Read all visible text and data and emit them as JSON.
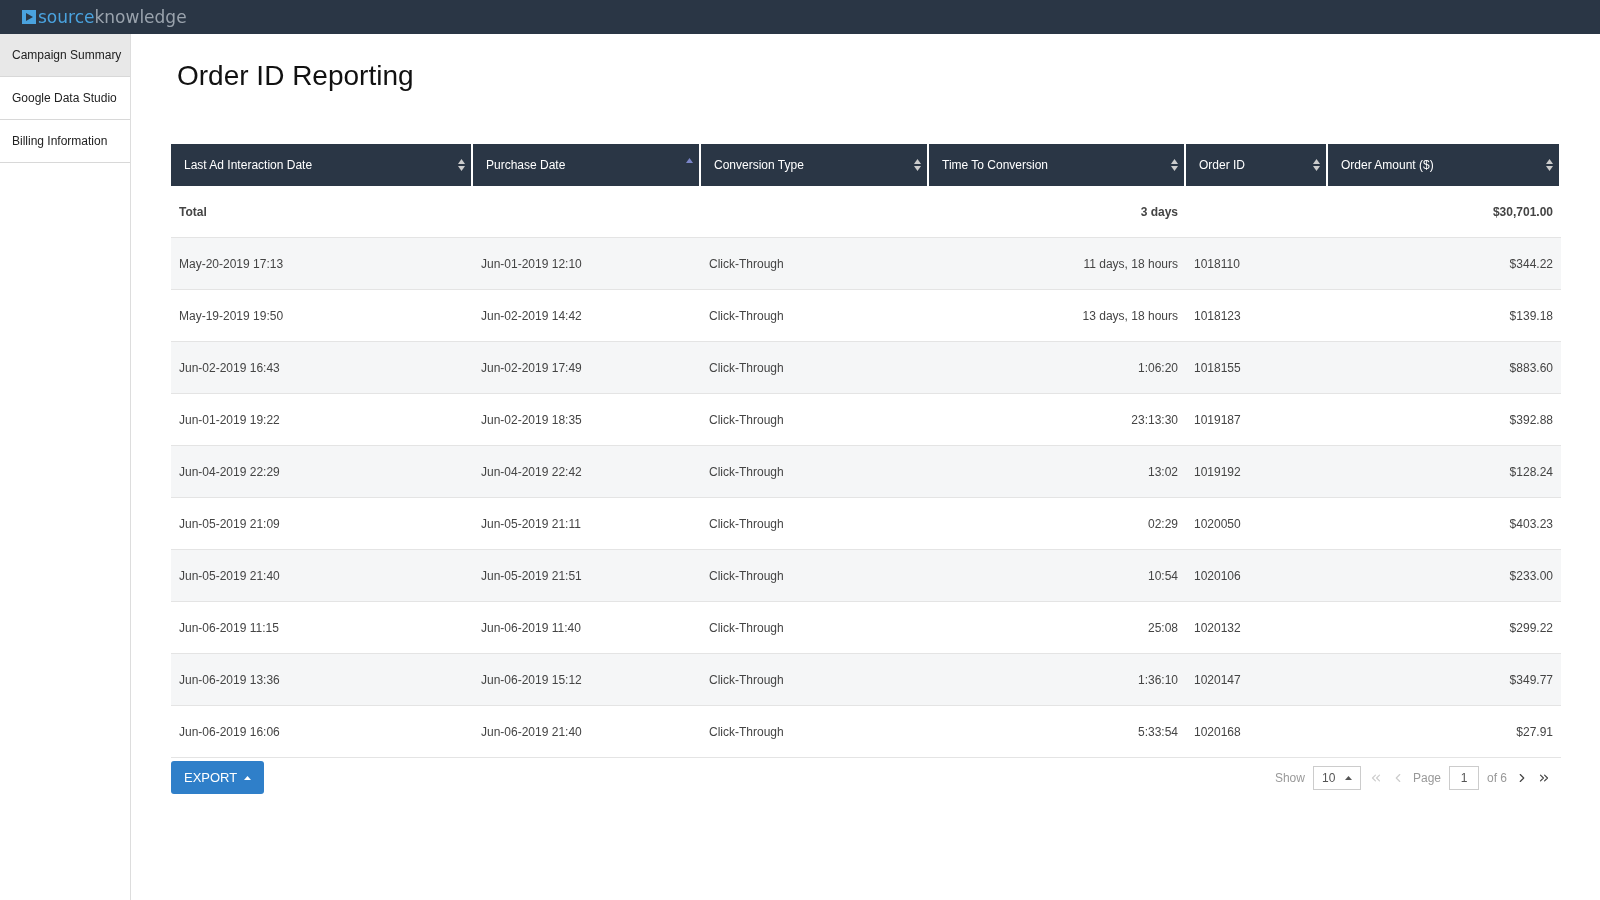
{
  "brand": {
    "part_1": "source",
    "part_2": "knowledge"
  },
  "sidebar": {
    "items": [
      {
        "label": "Campaign Summary",
        "selected": true
      },
      {
        "label": "Google Data Studio",
        "selected": false
      },
      {
        "label": "Billing Information",
        "selected": false
      }
    ]
  },
  "page_title": "Order ID Reporting",
  "table": {
    "columns": [
      {
        "label": "Last Ad Interaction Date",
        "sorted": false
      },
      {
        "label": "Purchase Date",
        "sorted": true
      },
      {
        "label": "Conversion Type",
        "sorted": false
      },
      {
        "label": "Time To Conversion",
        "sorted": false
      },
      {
        "label": "Order ID",
        "sorted": false
      },
      {
        "label": "Order Amount ($)",
        "sorted": false
      }
    ],
    "total": {
      "label": "Total",
      "time": "3 days",
      "amount": "$30,701.00"
    },
    "rows": [
      [
        "May-20-2019 17:13",
        "Jun-01-2019 12:10",
        "Click-Through",
        "11 days, 18 hours",
        "1018110",
        "$344.22"
      ],
      [
        "May-19-2019 19:50",
        "Jun-02-2019 14:42",
        "Click-Through",
        "13 days, 18 hours",
        "1018123",
        "$139.18"
      ],
      [
        "Jun-02-2019 16:43",
        "Jun-02-2019 17:49",
        "Click-Through",
        "1:06:20",
        "1018155",
        "$883.60"
      ],
      [
        "Jun-01-2019 19:22",
        "Jun-02-2019 18:35",
        "Click-Through",
        "23:13:30",
        "1019187",
        "$392.88"
      ],
      [
        "Jun-04-2019 22:29",
        "Jun-04-2019 22:42",
        "Click-Through",
        "13:02",
        "1019192",
        "$128.24"
      ],
      [
        "Jun-05-2019 21:09",
        "Jun-05-2019 21:11",
        "Click-Through",
        "02:29",
        "1020050",
        "$403.23"
      ],
      [
        "Jun-05-2019 21:40",
        "Jun-05-2019 21:51",
        "Click-Through",
        "10:54",
        "1020106",
        "$233.00"
      ],
      [
        "Jun-06-2019 11:15",
        "Jun-06-2019 11:40",
        "Click-Through",
        "25:08",
        "1020132",
        "$299.22"
      ],
      [
        "Jun-06-2019 13:36",
        "Jun-06-2019 15:12",
        "Click-Through",
        "1:36:10",
        "1020147",
        "$349.77"
      ],
      [
        "Jun-06-2019 16:06",
        "Jun-06-2019 21:40",
        "Click-Through",
        "5:33:54",
        "1020168",
        "$27.91"
      ]
    ]
  },
  "export_button": "EXPORT",
  "pagination": {
    "show_label": "Show",
    "page_size": "10",
    "page_label": "Page",
    "page": "1",
    "of_label": "of 6",
    "first_disabled": true,
    "prev_disabled": true,
    "next_disabled": false,
    "last_disabled": false
  }
}
